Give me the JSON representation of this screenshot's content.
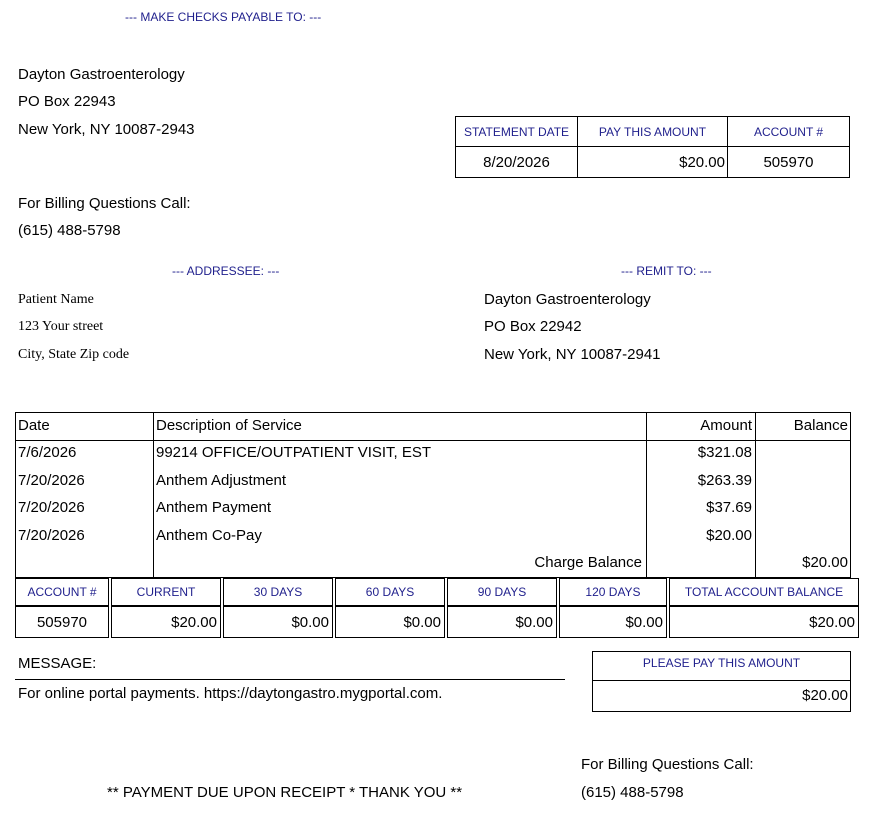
{
  "header": {
    "make_checks": "--- MAKE CHECKS PAYABLE TO: ---",
    "payee": [
      "Dayton Gastroenterology",
      "PO Box 22943",
      "New York, NY 10087-2943"
    ],
    "billing_label": "For Billing Questions Call:",
    "billing_phone": "(615) 488-5798"
  },
  "summary": {
    "statement_date_label": "STATEMENT DATE",
    "pay_amount_label": "PAY THIS AMOUNT",
    "account_label": "ACCOUNT #",
    "statement_date": "8/20/2026",
    "pay_amount": "$20.00",
    "account": "505970"
  },
  "addressee": {
    "title": "--- ADDRESSEE: ---",
    "lines": [
      "Patient Name",
      "123 Your street",
      "City, State Zip code"
    ]
  },
  "remit": {
    "title": "--- REMIT TO: ---",
    "lines": [
      "Dayton Gastroenterology",
      "PO Box 22942",
      "New York, NY 10087-2941"
    ]
  },
  "charges": {
    "headers": {
      "date": "Date",
      "description": "Description of Service",
      "amount": "Amount",
      "balance": "Balance"
    },
    "rows": [
      {
        "date": "7/6/2026",
        "description": "99214 OFFICE/OUTPATIENT VISIT, EST",
        "amount": "$321.08"
      },
      {
        "date": "7/20/2026",
        "description": "Anthem Adjustment",
        "amount": "$263.39"
      },
      {
        "date": "7/20/2026",
        "description": "Anthem Payment",
        "amount": "$37.69"
      },
      {
        "date": "7/20/2026",
        "description": "Anthem Co-Pay",
        "amount": "$20.00"
      }
    ],
    "charge_balance_label": "Charge Balance",
    "charge_balance": "$20.00"
  },
  "aging": {
    "headers": [
      "ACCOUNT #",
      "CURRENT",
      "30 DAYS",
      "60 DAYS",
      "90 DAYS",
      "120 DAYS",
      "TOTAL ACCOUNT BALANCE"
    ],
    "values": [
      "505970",
      "$20.00",
      "$0.00",
      "$0.00",
      "$0.00",
      "$0.00",
      "$20.00"
    ]
  },
  "message": {
    "label": "MESSAGE:",
    "text": "For online portal payments. https://daytongastro.mygportal.com."
  },
  "pay_box": {
    "label": "PLEASE PAY THIS AMOUNT",
    "amount": "$20.00"
  },
  "footer": {
    "due_text": "** PAYMENT DUE UPON RECEIPT * THANK YOU **",
    "billing_label": "For Billing Questions Call:",
    "billing_phone": "(615) 488-5798"
  }
}
